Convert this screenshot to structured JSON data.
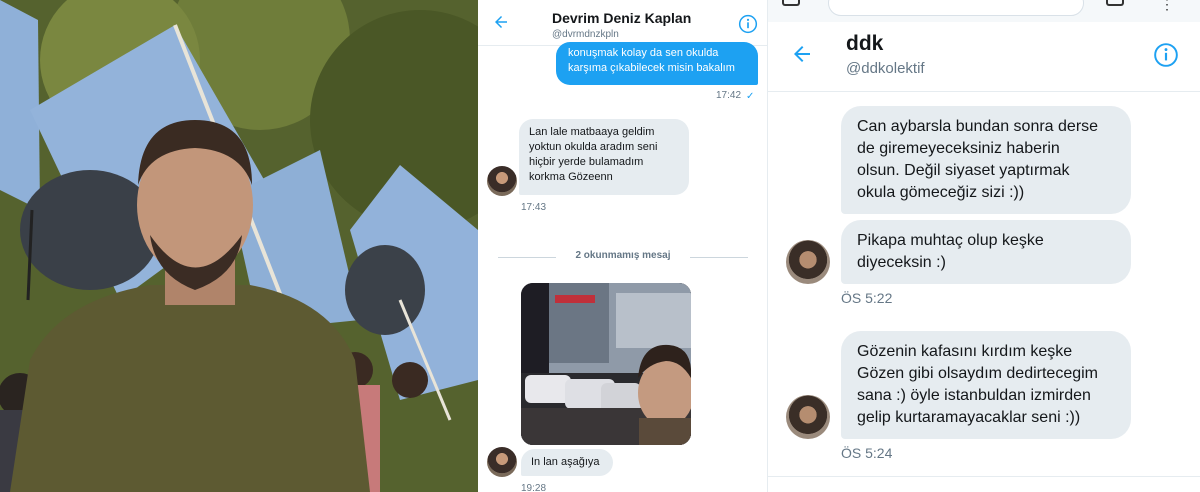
{
  "left_dm": {
    "name": "Devrim Deniz Kaplan",
    "handle": "@dvrmdnzkpln",
    "outgoing_text_1": "konuşmak kolay da sen okulda",
    "outgoing_text_2": "karşıma çıkabilecek misin bakalım",
    "outgoing_time": "17:42",
    "incoming_lines": [
      "Lan lale matbaaya geldim",
      "yoktun okulda aradım seni",
      "hiçbir yerde bulamadım",
      "korkma Gözeenn"
    ],
    "incoming_time": "17:43",
    "unread_divider": "2 okunmamış mesaj",
    "incoming_2": "In lan aşağıya",
    "incoming_2_time": "19:28"
  },
  "right_dm": {
    "name": "ddk",
    "handle": "@ddkolektif",
    "msg1_lines": [
      "Can aybarsla bundan sonra derse",
      "de giremeyeceksiniz haberin",
      "olsun. Değil siyaset yaptırmak",
      "okula gömeceğiz sizi :))"
    ],
    "msg2_lines": [
      "Pikapa muhtaç olup keşke",
      "diyeceksin :)"
    ],
    "time1": "ÖS 5:22",
    "msg3_lines": [
      "Gözenin kafasını kırdım keşke",
      "Gözen gibi olsaydım dedirtecegim",
      "sana :) öyle istanbuldan izmirden",
      "gelip kurtaramayacaklar seni :))"
    ],
    "time2": "ÖS 5:24"
  },
  "colors": {
    "accent": "#1da1f2",
    "bubble_gray": "#e6ecf0",
    "flag_blue": "#8fb0d8"
  },
  "icons": [
    "back-arrow-icon",
    "info-icon",
    "read-check-icon"
  ]
}
